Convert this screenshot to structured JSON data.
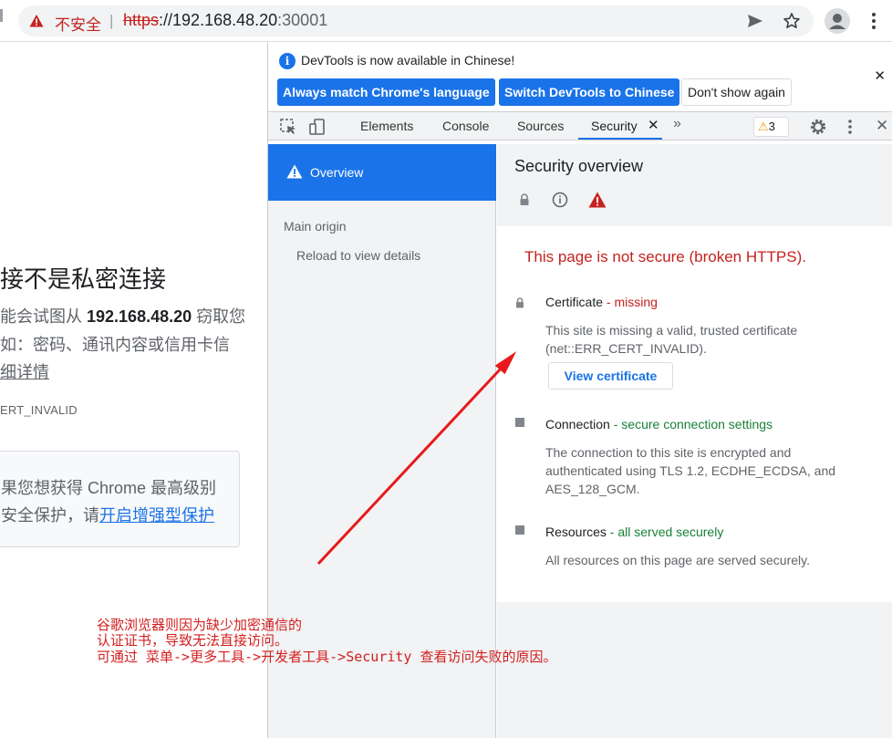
{
  "address_bar": {
    "security_label": "不安全",
    "separator": "|",
    "url_scheme": "https",
    "url_rest": "://192.168.48.20",
    "url_port": ":30001"
  },
  "page": {
    "title": "接不是私密连接",
    "line1_prefix": "能会试图从 ",
    "line1_host": "192.168.48.20",
    "line1_suffix": " 窃取您",
    "line2": "如：密码、通讯内容或信用卡信",
    "details_link": "细详情",
    "error_code": "ERT_INVALID",
    "box_line1": "果您想获得 Chrome 最高级别",
    "box_line2_prefix": "安全保护，请",
    "box_line2_link": "开启增强型保护"
  },
  "devtools": {
    "infobar": {
      "message": "DevTools is now available in Chinese!",
      "btn_match": "Always match Chrome's language",
      "btn_switch": "Switch DevTools to Chinese",
      "btn_dismiss": "Don't show again"
    },
    "tabs": [
      "Elements",
      "Console",
      "Sources",
      "Security"
    ],
    "issues_count": "3",
    "sidebar": {
      "overview": "Overview",
      "main_origin": "Main origin",
      "reload": "Reload to view details"
    },
    "security": {
      "title": "Security overview",
      "summary": "This page is not secure (broken HTTPS).",
      "certificate": {
        "title": "Certificate",
        "dash": " - ",
        "status": "missing",
        "desc": "This site is missing a valid, trusted certificate (net::ERR_CERT_INVALID).",
        "button": "View certificate"
      },
      "connection": {
        "title": "Connection",
        "dash": " - ",
        "status": "secure connection settings",
        "desc": "The connection to this site is encrypted and authenticated using TLS 1.2, ECDHE_ECDSA, and AES_128_GCM."
      },
      "resources": {
        "title": "Resources",
        "dash": " - ",
        "status": "all served securely",
        "desc": "All resources on this page are served securely."
      }
    }
  },
  "annotation": {
    "line1": "谷歌浏览器则因为缺少加密通信的",
    "line2": "认证证书，导致无法直接访问。",
    "line3": "可通过 菜单->更多工具->开发者工具->Security 查看访问失败的原因。"
  },
  "colors": {
    "accent": "#1a73e8",
    "danger": "#c5221f",
    "success": "#188038",
    "annotation": "#d21f1f"
  }
}
